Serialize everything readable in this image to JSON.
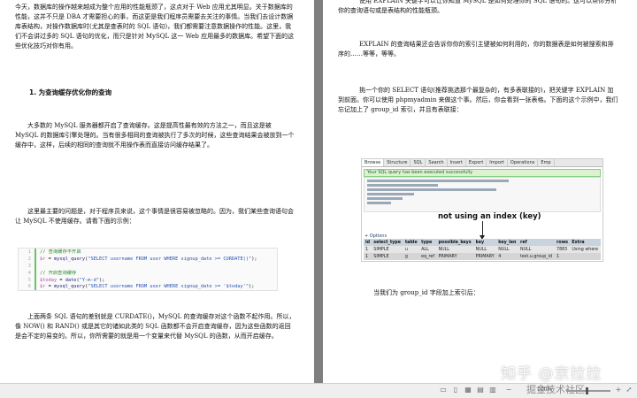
{
  "left_page": {
    "intro": "今天，数据库的操作越来越成为整个应用的性能瓶颈了，这点对于 Web 应用尤其明显。关于数据库的性能，这并不只是 DBA 才需要担心的事，而这更是我们程序员需要去关注的事情。当我们去设计数据库表结构，对操作数据库时(尤其是查表时的 SQL 语句)，我们都需要注意数据操作的性能。这里，我们不会讲过多的 SQL 语句的优化，而只是针对 MySQL 这一 Web 应用最多的数据库。希望下面的这些优化技巧对你有用。",
    "heading": "1.  为查询缓存优化你的查询",
    "para1": "大多数的 MySQL 服务器都开启了查询缓存。这是提高性最有效的方法之一，而且这是被 MySQL 的数据库引擎处理的。当有很多相同的查询被执行了多次的时候，这些查询结果会被放到一个缓存中，这样，后续的相同的查询就不用操作表而直接访问缓存结果了。",
    "para2": "这里最主要的问题是，对于程序员来说，这个事情是很容易被忽略的。因为，我们某些查询语句会让 MySQL 不使用缓存。请看下面的示例：",
    "code": [
      {
        "num": "1",
        "comment": "// 查询缓存不开启"
      },
      {
        "num": "2",
        "var": "$r",
        "pre": " = ",
        "fn": "mysql_query",
        "str": "\"SELECT username FROM user WHERE signup_date >= CURDATE()\"",
        "post": ");"
      },
      {
        "num": "3",
        "comment": ""
      },
      {
        "num": "4",
        "comment": "// 开启查询缓存"
      },
      {
        "num": "5",
        "var": "$today",
        "pre": " = ",
        "fn": "date",
        "str": "\"Y-m-d\"",
        "post": ");"
      },
      {
        "num": "6",
        "var": "$r",
        "pre": " = ",
        "fn": "mysql_query",
        "str": "\"SELECT username FROM user WHERE signup_date >= '$today'\"",
        "post": ");"
      }
    ],
    "para3": "上面两条 SQL 语句的差别就是 CURDATE()，MySQL 的查询缓存对这个函数不起作用。所以，像 NOW() 和 RAND() 或是其它的诸如此类的 SQL 函数都不会开启查询缓存，因为这些函数的返回是会不定的易变的。所以，你所需要的就是用一个变量来代替 MySQL 的函数，从而开启缓存。"
  },
  "right_page": {
    "para1": "使用 EXPLAIN 关键字可以让你知道 MySQL 是如何处理你的 SQL 语句的。这可以帮你分析你的查询语句或是表结构的性能瓶颈。",
    "para2": "EXPLAIN 的查询结果还会告诉你你的索引主键被如何利用的，你的数据表是如何被搜索和排序的……等等，等等。",
    "para3": "挑一个你的 SELECT 语句(推荐挑选那个最复杂的，有多表联接的)，把关键字 EXPLAIN 加到前面。你可以使用 phpmyadmin 来做这个事。然后，你会看到一张表格。下面的这个示例中，我们忘记加上了 group_id 索引，并且有表联接：",
    "para4": "当我们为 group_id 字段加上索引后："
  },
  "pma": {
    "tabs": [
      "Browse",
      "Structure",
      "SQL",
      "Search",
      "Insert",
      "Export",
      "Import",
      "Operations",
      "Emp"
    ],
    "success": "Your SQL query has been executed successfully",
    "annotation": "not using an index (key)",
    "options": "+ Options",
    "columns": [
      "id",
      "select_type",
      "table",
      "type",
      "possible_keys",
      "key",
      "key_len",
      "ref",
      "rows",
      "Extra"
    ],
    "rows": [
      [
        "1",
        "SIMPLE",
        "u",
        "ALL",
        "NULL",
        "NULL",
        "NULL",
        "NULL",
        "7883",
        "Using where"
      ],
      [
        "1",
        "SIMPLE",
        "g",
        "eq_ref",
        "PRIMARY",
        "PRIMARY",
        "4",
        "test.u.group_id",
        "1",
        ""
      ]
    ]
  },
  "footer": {
    "watermark": "知乎 @京拉拉",
    "footer_watermark": "掘金技术社区",
    "zoom": "100%"
  }
}
